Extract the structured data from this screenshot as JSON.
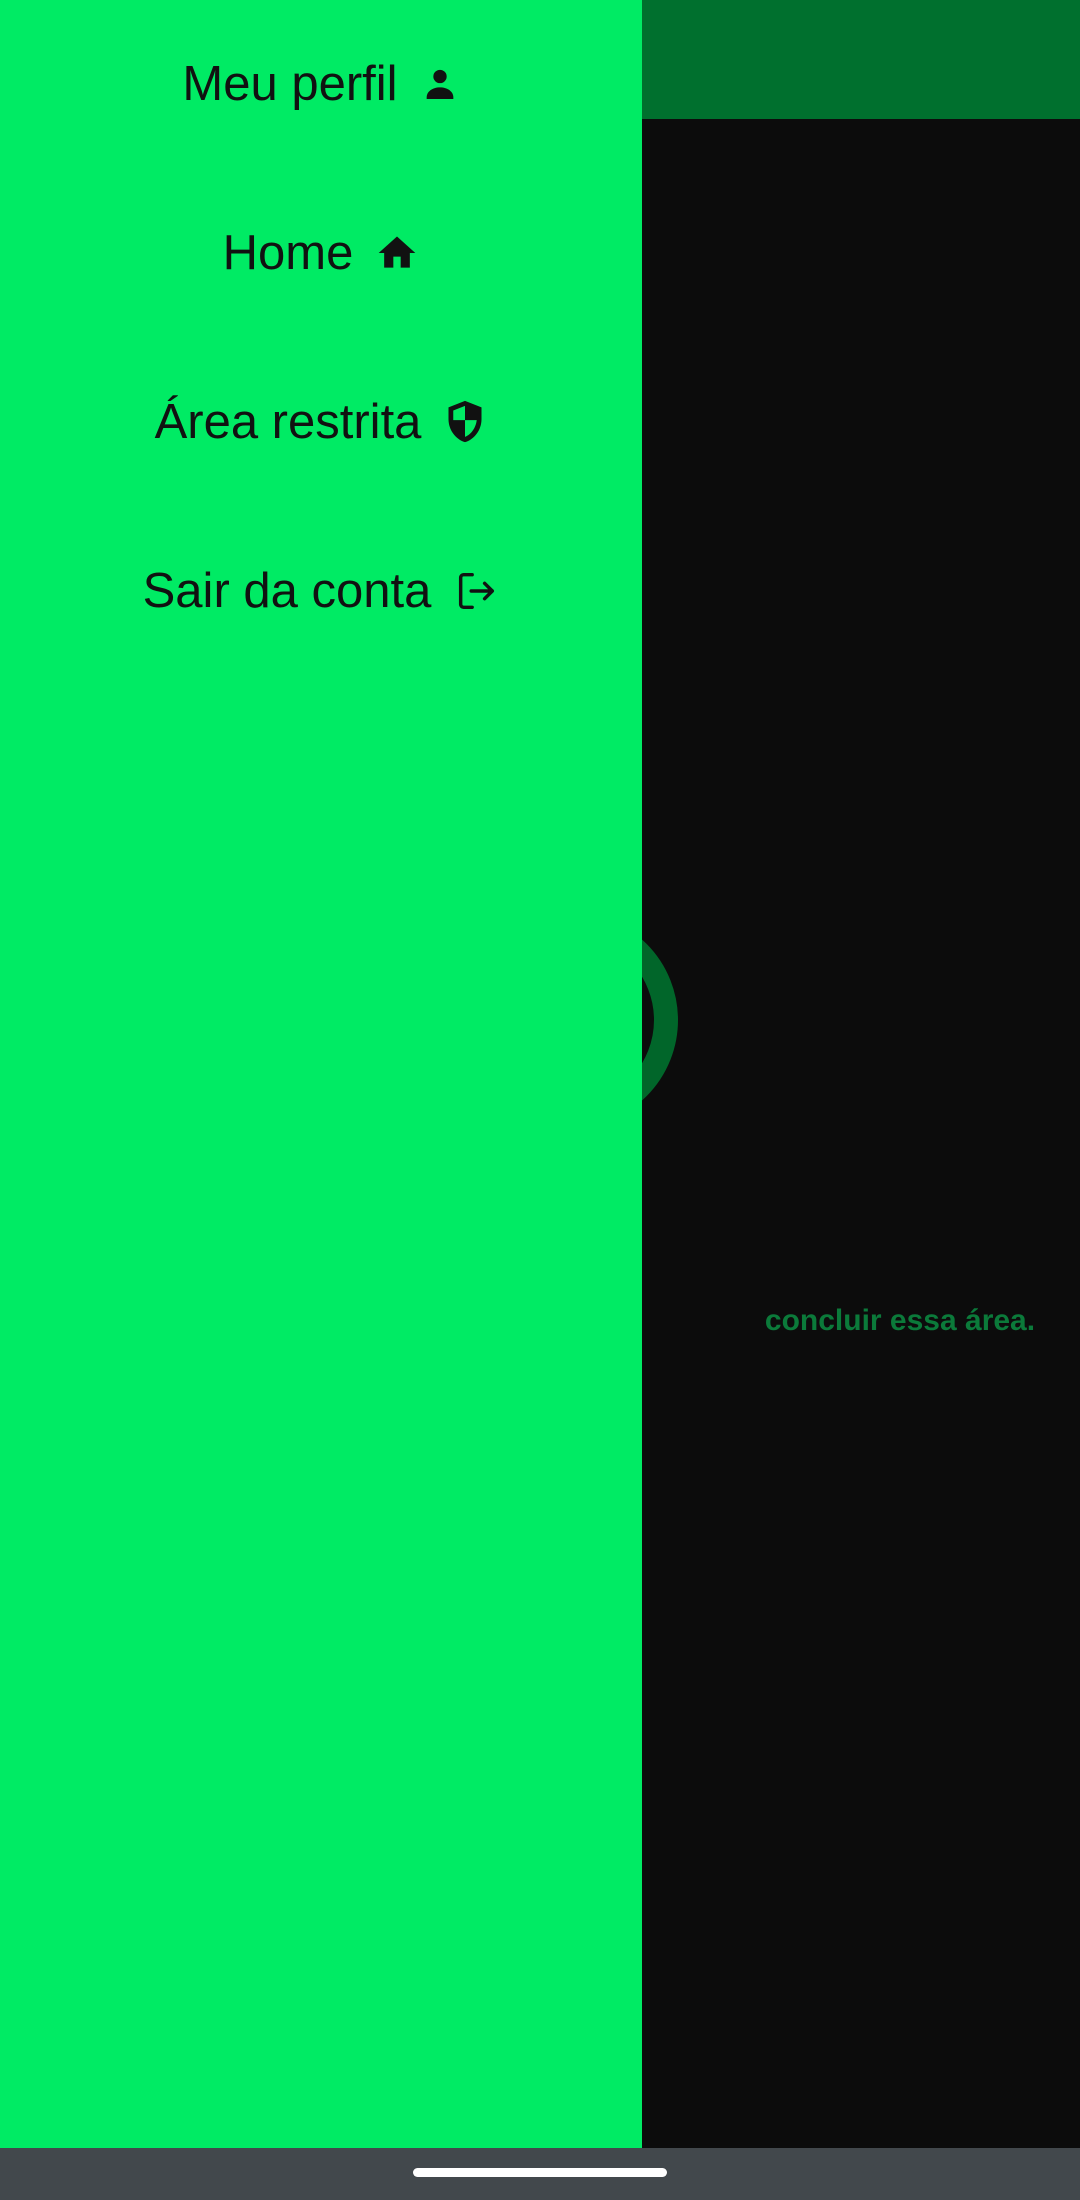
{
  "background": {
    "message": "concluir essa área."
  },
  "drawer": {
    "items": [
      {
        "label": "Meu perfil",
        "icon": "person-icon"
      },
      {
        "label": "Home",
        "icon": "home-icon"
      },
      {
        "label": "Área restrita",
        "icon": "shield-icon"
      },
      {
        "label": "Sair da conta",
        "icon": "logout-icon"
      }
    ]
  },
  "colors": {
    "drawer": "#00eb64",
    "app_bar_dimmed": "#00702e",
    "content_dimmed": "#0c0c0c",
    "text": "#111111",
    "system_nav": "#42484c"
  }
}
